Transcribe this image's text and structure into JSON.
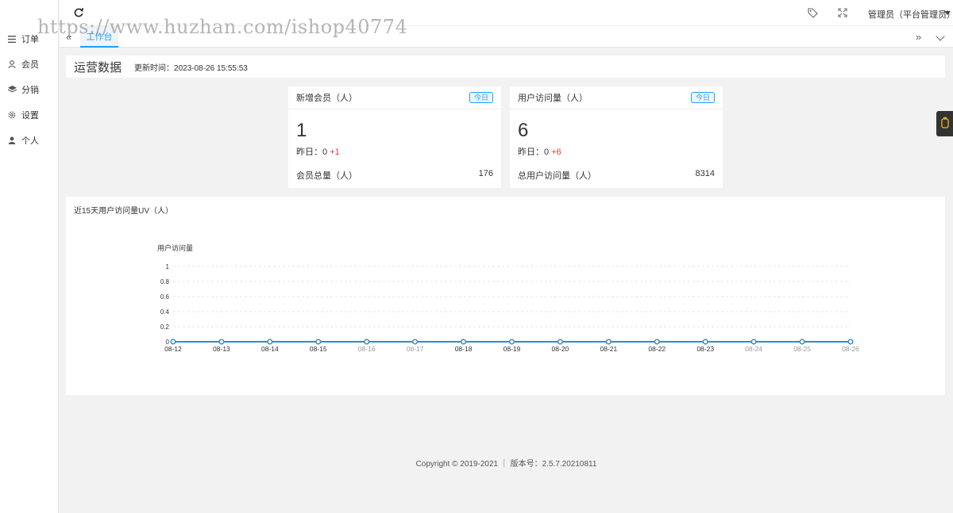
{
  "sidebar": {
    "items": [
      {
        "label": "订单",
        "icon": "list-icon"
      },
      {
        "label": "会员",
        "icon": "user-outline-icon"
      },
      {
        "label": "分销",
        "icon": "layers-icon"
      },
      {
        "label": "设置",
        "icon": "gear-icon"
      },
      {
        "label": "个人",
        "icon": "person-icon"
      }
    ]
  },
  "topbar": {
    "admin_label": "管理员（平台管理员）"
  },
  "tabs": {
    "active_label": "工作台"
  },
  "watermark": "https://www.huzhan.com/ishop40774",
  "header": {
    "title": "运营数据",
    "updated": "更新时间：2023-08-26 15:55:53"
  },
  "stats": [
    {
      "title": "新增会员（人）",
      "badge": "今日",
      "value": "1",
      "yesterday_label": "昨日：",
      "yesterday_value": "0",
      "delta": "+1",
      "total_label": "会员总量（人）",
      "total_value": "176"
    },
    {
      "title": "用户访问量（人）",
      "badge": "今日",
      "value": "6",
      "yesterday_label": "昨日：",
      "yesterday_value": "0",
      "delta": "+6",
      "total_label": "总用户访问量（人）",
      "total_value": "8314"
    }
  ],
  "chart_title": "近15天用户访问量UV（人）",
  "chart_data": {
    "type": "line",
    "ylabel": "用户访问量",
    "categories": [
      "08-12",
      "08-13",
      "08-14",
      "08-15",
      "08-16",
      "08-17",
      "08-18",
      "08-19",
      "08-20",
      "08-21",
      "08-22",
      "08-23",
      "08-24",
      "08-25",
      "08-26"
    ],
    "values": [
      0,
      0,
      0,
      0,
      0,
      0,
      0,
      0,
      0,
      0,
      0,
      0,
      0,
      0,
      0
    ],
    "ylim": [
      0,
      1
    ],
    "yticks": [
      "0",
      "0.2",
      "0.4",
      "0.6",
      "0.8",
      "1"
    ],
    "grid": true,
    "color": "#2b8fd6"
  },
  "footer": "Copyright © 2019-2021 ｜ 版本号：2.5.7.20210811",
  "colors": {
    "accent": "#1e9fff",
    "up": "#e53935"
  }
}
